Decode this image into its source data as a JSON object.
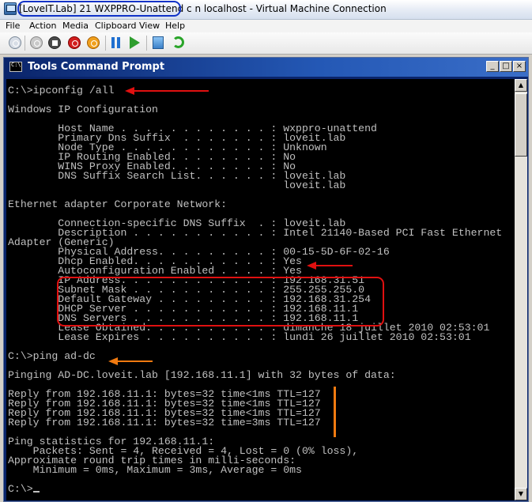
{
  "window": {
    "title": "[LoveIT.Lab] 21 WXPPRO-Unattend c n localhost - Virtual Machine Connection"
  },
  "menu": [
    "File",
    "Action",
    "Media",
    "Clipboard",
    "View",
    "Help"
  ],
  "toolbar": {
    "icons": [
      "ctrl-alt-del-icon",
      "turn-off-icon",
      "stop-icon",
      "shutdown-icon",
      "save-state-icon",
      "pause-icon",
      "start-icon",
      "snapshot-icon",
      "revert-icon"
    ]
  },
  "console": {
    "title": "Tools Command Prompt",
    "buttons": {
      "minimize": "_",
      "maximize": "□",
      "close": "×"
    },
    "lines": [
      "C:\\>ipconfig /all",
      "",
      "Windows IP Configuration",
      "",
      "        Host Name . . . . . . . . . . . . : wxppro-unattend",
      "        Primary Dns Suffix  . . . . . . . : loveit.lab",
      "        Node Type . . . . . . . . . . . . : Unknown",
      "        IP Routing Enabled. . . . . . . . : No",
      "        WINS Proxy Enabled. . . . . . . . : No",
      "        DNS Suffix Search List. . . . . . : loveit.lab",
      "                                            loveit.lab",
      "",
      "Ethernet adapter Corporate Network:",
      "",
      "        Connection-specific DNS Suffix  . : loveit.lab",
      "        Description . . . . . . . . . . . : Intel 21140-Based PCI Fast Ethernet",
      "Adapter (Generic)",
      "        Physical Address. . . . . . . . . : 00-15-5D-6F-02-16",
      "        Dhcp Enabled. . . . . . . . . . . : Yes",
      "        Autoconfiguration Enabled . . . . : Yes",
      "        IP Address. . . . . . . . . . . . : 192.168.31.51",
      "        Subnet Mask . . . . . . . . . . . : 255.255.255.0",
      "        Default Gateway . . . . . . . . . : 192.168.31.254",
      "        DHCP Server . . . . . . . . . . . : 192.168.11.1",
      "        DNS Servers . . . . . . . . . . . : 192.168.11.1",
      "        Lease Obtained. . . . . . . . . . : dimanche 18 juillet 2010 02:53:01",
      "        Lease Expires . . . . . . . . . . : lundi 26 juillet 2010 02:53:01",
      "",
      "C:\\>ping ad-dc",
      "",
      "Pinging AD-DC.loveit.lab [192.168.11.1] with 32 bytes of data:",
      "",
      "Reply from 192.168.11.1: bytes=32 time<1ms TTL=127",
      "Reply from 192.168.11.1: bytes=32 time<1ms TTL=127",
      "Reply from 192.168.11.1: bytes=32 time<1ms TTL=127",
      "Reply from 192.168.11.1: bytes=32 time=3ms TTL=127",
      "",
      "Ping statistics for 192.168.11.1:",
      "    Packets: Sent = 4, Received = 4, Lost = 0 (0% loss),",
      "Approximate round trip times in milli-seconds:",
      "    Minimum = 0ms, Maximum = 3ms, Average = 0ms",
      "",
      "C:\\>"
    ]
  },
  "colors": {
    "console_bg": "#000000",
    "console_text": "#c0c0c0",
    "annotation_red": "#e01010",
    "annotation_orange": "#f07a10",
    "annotation_blue": "#1033c8"
  }
}
